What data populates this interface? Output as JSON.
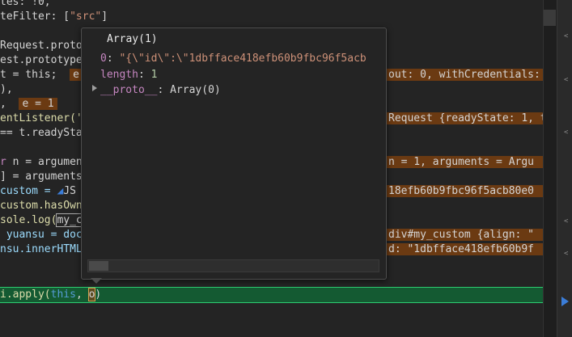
{
  "editor": {
    "line1": "tes: !0,",
    "line2a": "teFilter: [",
    "line2b": "\"src\"",
    "line2c": "]",
    "line3": "Request.proto",
    "line4": "est.prototype",
    "line5a": "t = this;",
    "line5b": "e",
    "line5c": "out: 0, withCredentials:",
    "line6": "),",
    "line7a": ",",
    "line7b": "e = 1",
    "line8a": "entListener('",
    "line8b": "Request {readyState: 1, t",
    "line9": "== t.readySta",
    "line10a": "r",
    "line10b": " n = argumen",
    "line10c": "n = 1, arguments = Argu",
    "line11": "] = arguments",
    "line12a": "custom = ",
    "line12b": "JS",
    "line12c": "18efb60b9fbc96f5acb80e0",
    "line13": "custom.hasOwn",
    "line14a": "sole.log(",
    "line14b": "my_c",
    "line15a": " yuansu = doc",
    "line15b": "div#my_custom {align: \"",
    "line16a": "nsu.innerHTML",
    "line16b": "d: \"1dbfface418efb60b9f",
    "current_line_a": "i.apply(",
    "current_line_b": "this",
    "current_line_c": ", ",
    "current_line_d": "o",
    "current_line_e": ")"
  },
  "popover": {
    "title": "Array(1)",
    "row0_key": "0",
    "row0_value": "\"{\\\"id\\\":\\\"1dbfface418efb60b9fbc96f5acb",
    "row1_key": "length",
    "row1_value": "1",
    "row2_key": "__proto__",
    "row2_value": "Array(0)"
  },
  "gutter": {
    "marks": [
      "<",
      "<",
      "<",
      "<",
      "<"
    ]
  },
  "colors": {
    "current_line_bg": "#145a32",
    "highlight_bg": "#6b3a12",
    "popover_bg": "#242424"
  }
}
